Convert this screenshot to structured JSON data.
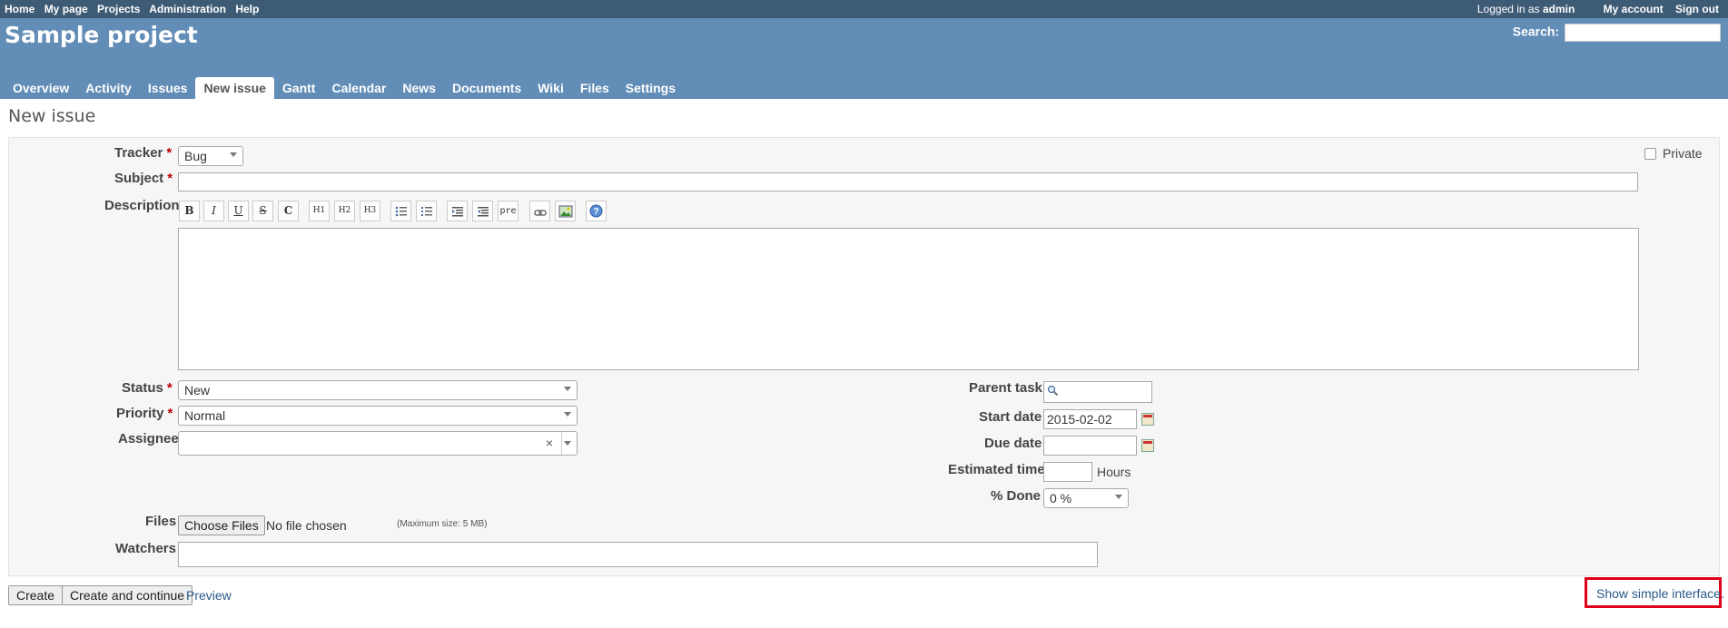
{
  "top_menu": {
    "items": [
      "Home",
      "My page",
      "Projects",
      "Administration",
      "Help"
    ],
    "logged_in_prefix": "Logged in as",
    "user": "admin",
    "my_account": "My account",
    "sign_out": "Sign out"
  },
  "header": {
    "project_title": "Sample project",
    "search_label": "Search:",
    "search_value": ""
  },
  "tabs": [
    "Overview",
    "Activity",
    "Issues",
    "New issue",
    "Gantt",
    "Calendar",
    "News",
    "Documents",
    "Wiki",
    "Files",
    "Settings"
  ],
  "selected_tab": "New issue",
  "page_title": "New issue",
  "form": {
    "tracker_label": "Tracker",
    "tracker_value": "Bug",
    "private_label": "Private",
    "subject_label": "Subject",
    "description_label": "Description",
    "toolbar": [
      "B",
      "I",
      "U",
      "S",
      "C",
      "H1",
      "H2",
      "H3",
      "ul",
      "ol",
      "indent-left",
      "indent-right",
      "pre",
      "link",
      "image",
      "help"
    ],
    "status_label": "Status",
    "status_value": "New",
    "priority_label": "Priority",
    "priority_value": "Normal",
    "assignee_label": "Assignee",
    "assignee_clear": "×",
    "parent_task_label": "Parent task",
    "start_date_label": "Start date",
    "start_date_value": "2015-02-02",
    "due_date_label": "Due date",
    "estimated_time_label": "Estimated time",
    "hours_label": "Hours",
    "done_label": "% Done",
    "done_value": "0 %",
    "files_label": "Files",
    "choose_files": "Choose Files",
    "no_file": "No file chosen",
    "max_size": "(Maximum size: 5 MB)",
    "watchers_label": "Watchers",
    "required_mark": "*"
  },
  "actions": {
    "create": "Create",
    "create_continue": "Create and continue",
    "preview": "Preview",
    "show_simple": "Show simple interface."
  },
  "colors": {
    "top_bar": "#3e5b76",
    "header": "#628db6",
    "highlight": "#e0001a"
  }
}
